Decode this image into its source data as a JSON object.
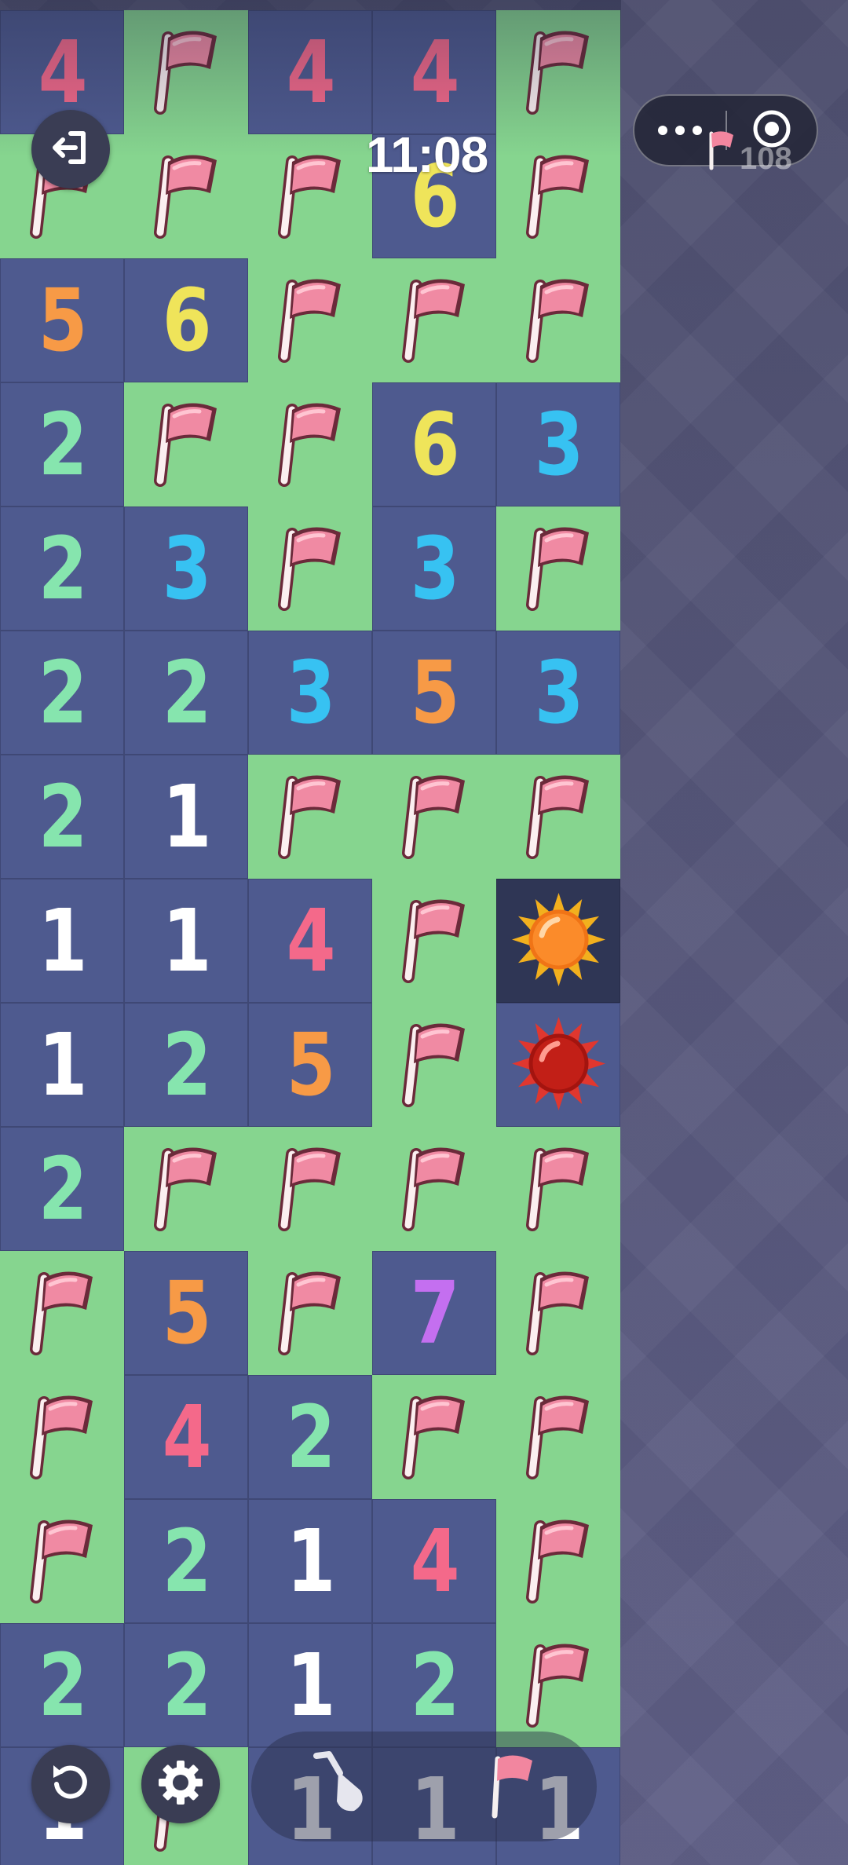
{
  "hud": {
    "clock": "11:08",
    "flag_count": "108"
  },
  "icons": {
    "exit": "exit-icon",
    "restart": "restart-icon",
    "settings": "gear-icon",
    "more": "more-icon",
    "target": "target-icon",
    "shovel": "shovel-icon",
    "flag": "flag-icon"
  },
  "colors": {
    "revealed": "#4e5a8f",
    "hidden": "#86d58f",
    "n1": "#ffffff",
    "n2": "#86e5ae",
    "n3": "#37c2f2",
    "n4": "#f4698a",
    "n5": "#f79a46",
    "n6": "#efe45a",
    "n7": "#c46ff0"
  },
  "board": {
    "legend": "R=revealed empty, F=flag on hidden tile, H=hidden tile, M=exploded-mine (safe), X=mine hit, digit=revealed number",
    "rows": [
      [
        "4",
        "F",
        "4",
        "4",
        "F"
      ],
      [
        "F",
        "F",
        "F",
        "6",
        "F"
      ],
      [
        "5",
        "6",
        "F",
        "F",
        "F"
      ],
      [
        "2",
        "F",
        "F",
        "6",
        "3"
      ],
      [
        "2",
        "3",
        "F",
        "3",
        "F"
      ],
      [
        "2",
        "2",
        "3",
        "5",
        "3"
      ],
      [
        "2",
        "1",
        "F",
        "F",
        "F"
      ],
      [
        "1",
        "1",
        "4",
        "F",
        "M"
      ],
      [
        "1",
        "2",
        "5",
        "F",
        "X"
      ],
      [
        "2",
        "F",
        "F",
        "F",
        "F"
      ],
      [
        "F",
        "5",
        "F",
        "7",
        "F"
      ],
      [
        "F",
        "4",
        "2",
        "F",
        "F"
      ],
      [
        "F",
        "2",
        "1",
        "4",
        "F"
      ],
      [
        "2",
        "2",
        "1",
        "2",
        "F"
      ],
      [
        "1",
        "F",
        "1",
        "1",
        "1"
      ]
    ]
  }
}
